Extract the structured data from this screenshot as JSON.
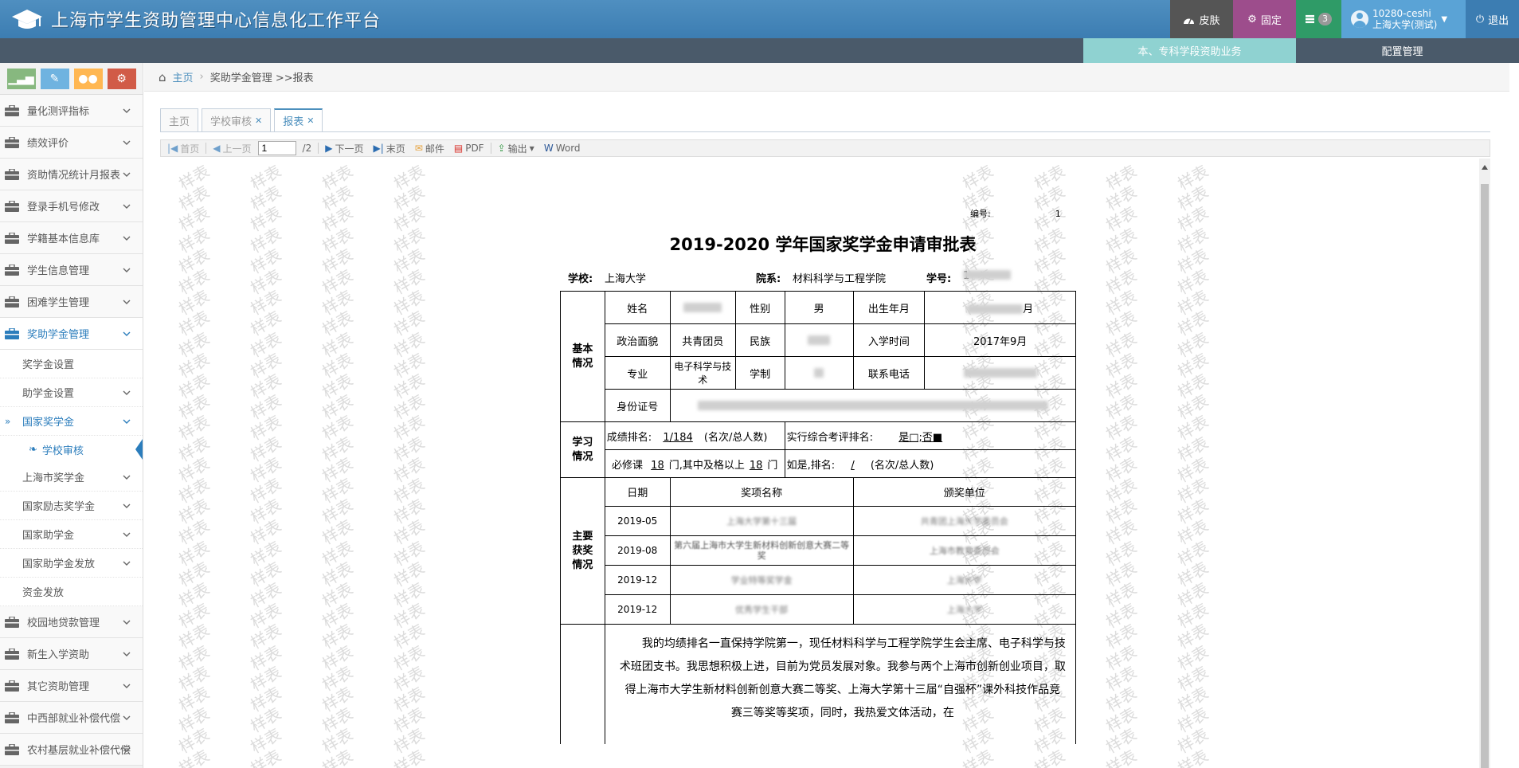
{
  "header": {
    "title": "上海市学生资助管理中心信息化工作平台",
    "skin_label": "皮肤",
    "pin_label": "固定",
    "task_count": "3",
    "user_id": "10280-ceshi",
    "user_org": "上海大学(测试)",
    "logout_label": "退出"
  },
  "modules": {
    "active": "本、专科学段资助业务",
    "other": "配置管理"
  },
  "sidebar": {
    "items": [
      {
        "label": "量化测评指标"
      },
      {
        "label": "绩效评价"
      },
      {
        "label": "资助情况统计月报表"
      },
      {
        "label": "登录手机号修改"
      },
      {
        "label": "学籍基本信息库"
      },
      {
        "label": "学生信息管理"
      },
      {
        "label": "困难学生管理"
      },
      {
        "label": "奖助学金管理"
      },
      {
        "label": "校园地贷款管理"
      },
      {
        "label": "新生入学资助"
      },
      {
        "label": "其它资助管理"
      },
      {
        "label": "中西部就业补偿代偿"
      },
      {
        "label": "农村基层就业补偿代偿"
      }
    ],
    "subitems": [
      {
        "label": "奖学金设置"
      },
      {
        "label": "助学金设置"
      },
      {
        "label": "国家奖学金"
      },
      {
        "label": "学校审核"
      },
      {
        "label": "上海市奖学金"
      },
      {
        "label": "国家励志奖学金"
      },
      {
        "label": "国家助学金"
      },
      {
        "label": "国家助学金发放"
      },
      {
        "label": "资金发放"
      }
    ]
  },
  "breadcrumb": {
    "home": "主页",
    "path": "奖助学金管理 >>报表"
  },
  "tabs": [
    {
      "label": "主页"
    },
    {
      "label": "学校审核"
    },
    {
      "label": "报表"
    }
  ],
  "toolbar": {
    "first": "首页",
    "prev": "上一页",
    "page_value": "1",
    "page_total": "/2",
    "next": "下一页",
    "last": "末页",
    "mail": "邮件",
    "pdf": "PDF",
    "export": "输出",
    "word": "Word"
  },
  "watermark_text": "样表",
  "document": {
    "serial_label": "编号:",
    "serial_value": "1",
    "title": "2019-2020 学年国家奖学金申请审批表",
    "school_label": "学校:",
    "school": "上海大学",
    "dept_label": "院系:",
    "dept": "材料科学与工程学院",
    "stuno_label": "学号:",
    "stuno_prefix": "1",
    "basic": {
      "section": "基本情况",
      "name_label": "姓名",
      "gender_label": "性别",
      "gender": "男",
      "birth_label": "出生年月",
      "birth_suffix": "月",
      "politics_label": "政治面貌",
      "politics": "共青团员",
      "ethnic_label": "民族",
      "enroll_label": "入学时间",
      "enroll": "2017年9月",
      "major_label": "专业",
      "major": "电子科学与技术",
      "length_label": "学制",
      "phone_label": "联系电话",
      "id_label": "身份证号"
    },
    "study": {
      "section": "学习情况",
      "rank_label": "成绩排名:",
      "rank_value": "1/184",
      "rank_unit": "(名次/总人数)",
      "eval_label": "实行综合考评排名:",
      "eval_value": "是□;否■",
      "courses_label": "必修课",
      "courses_total": "18",
      "courses_mid": "门,其中及格以上",
      "courses_pass": "18",
      "courses_unit": "门",
      "ifyes_label": "如是,排名:",
      "ifyes_value": "/",
      "ifyes_unit": "(名次/总人数)"
    },
    "awards": {
      "section": "主要获奖情况",
      "col_date": "日期",
      "col_name": "奖项名称",
      "col_org": "颁奖单位",
      "rows": [
        {
          "date": "2019-05",
          "name_visible": "上海大学第十三届",
          "org_visible": "共青团上海大学委员会"
        },
        {
          "date": "2019-08",
          "name_visible": "第六届上海市大学生新材料创新创意大赛二等奖",
          "org_visible": "上海市教育委员会"
        },
        {
          "date": "2019-12",
          "name_visible": "学业特等奖学金",
          "org_visible": "上海大学"
        },
        {
          "date": "2019-12",
          "name_visible": "优秀学生干部",
          "org_visible": "上海大学"
        }
      ]
    },
    "statement": "我的均绩排名一直保持学院第一，现任材料科学与工程学院学生会主席、电子科学与技术班团支书。我思想积极上进，目前为党员发展对象。我参与两个上海市创新创业项目，取得上海市大学生新材料创新创意大赛二等奖、上海大学第十三届“自强杯”课外科技作品竞赛三等奖等奖项，同时，我热爱文体活动，在"
  }
}
